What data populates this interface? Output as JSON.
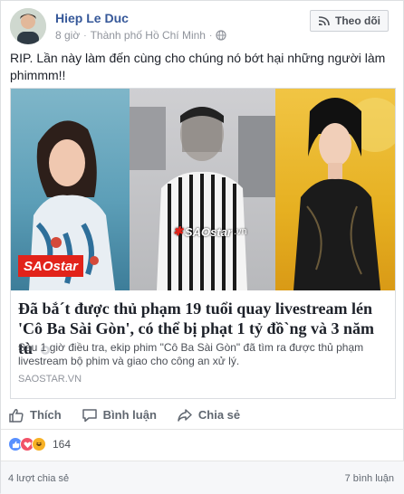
{
  "post": {
    "author": "Hiep Le Duc",
    "time": "8 giờ",
    "separator": "·",
    "location": "Thành phố Hồ Chí Minh",
    "follow_label": "Theo dõi",
    "text": "RIP. Lần này làm đến cùng cho chúng nó bớt hại những người làm phimmm!!"
  },
  "link": {
    "title": "Đã bắ´t được thủ phạm 19 tuổi quay livestream lén 'Cô Ba Sài Gòn', có thể bị phạt 1 tỷ đồ`ng và 3 năm tù",
    "description": "Sau 1 giờ điều tra, ekip phim \"Cô Ba Sài Gòn\" đã tìm ra được thủ phạm livestream bộ phim và giao cho công an xử lý.",
    "domain": "SAOSTAR.VN",
    "image_logo_left": "SAOstar",
    "image_logo_mid_star": "✱",
    "image_logo_mid_text": "SAOstar",
    "image_logo_mid_suffix": ".vn"
  },
  "actions": {
    "like": "Thích",
    "comment": "Bình luận",
    "share": "Chia sẻ"
  },
  "reactions": {
    "count": "164",
    "types": [
      "like-icon",
      "love-icon",
      "haha-icon"
    ],
    "colors": {
      "like": "#5890ff",
      "love": "#f25268",
      "haha": "#f7b125"
    }
  },
  "stats": {
    "shares": "4 lượt chia sẻ",
    "comments": "7 bình luận"
  },
  "colors": {
    "author": "#365899",
    "meta": "#90949c",
    "logo_red": "#e2231a"
  }
}
